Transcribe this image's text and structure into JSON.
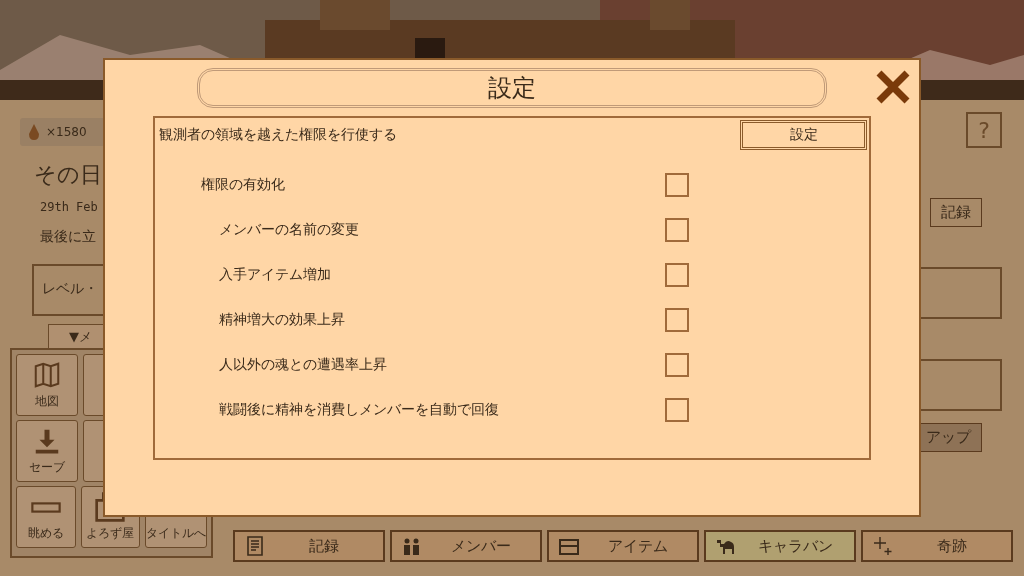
{
  "background": {
    "currency": "×1580",
    "title": "その日",
    "date": "29th Feb",
    "note": "最後に立",
    "level_box": "レベル・",
    "menu_tab": "▼メ",
    "tiles": [
      {
        "kind": "map",
        "label": "地図"
      },
      {
        "kind": "blank"
      },
      {
        "kind": "save",
        "label": "セーブ"
      },
      {
        "kind": "blank"
      },
      {
        "kind": "view",
        "label": "眺める"
      },
      {
        "kind": "shop",
        "label": "よろず屋"
      },
      {
        "kind": "title",
        "label": "タイトルへ"
      }
    ],
    "help_button": "?",
    "record_button": "記録",
    "up_button": "アップ"
  },
  "tabs": [
    {
      "kind": "record",
      "label": "記録",
      "selected": false
    },
    {
      "kind": "members",
      "label": "メンバー",
      "selected": false
    },
    {
      "kind": "items",
      "label": "アイテム",
      "selected": false
    },
    {
      "kind": "caravan",
      "label": "キャラバン",
      "selected": true
    },
    {
      "kind": "miracle",
      "label": "奇跡",
      "selected": false
    }
  ],
  "dialog": {
    "title": "設定",
    "section": {
      "heading": "観測者の領域を越えた権限を行使する",
      "button": "設定",
      "options": [
        {
          "label": "権限の有効化",
          "checked": false,
          "children": [
            {
              "label": "メンバーの名前の変更",
              "checked": false
            },
            {
              "label": "入手アイテム増加",
              "checked": false
            },
            {
              "label": "精神増大の効果上昇",
              "checked": false
            },
            {
              "label": "人以外の魂との遭遇率上昇",
              "checked": false
            },
            {
              "label": "戦闘後に精神を消費しメンバーを自動で回復",
              "checked": false
            }
          ]
        }
      ]
    }
  }
}
